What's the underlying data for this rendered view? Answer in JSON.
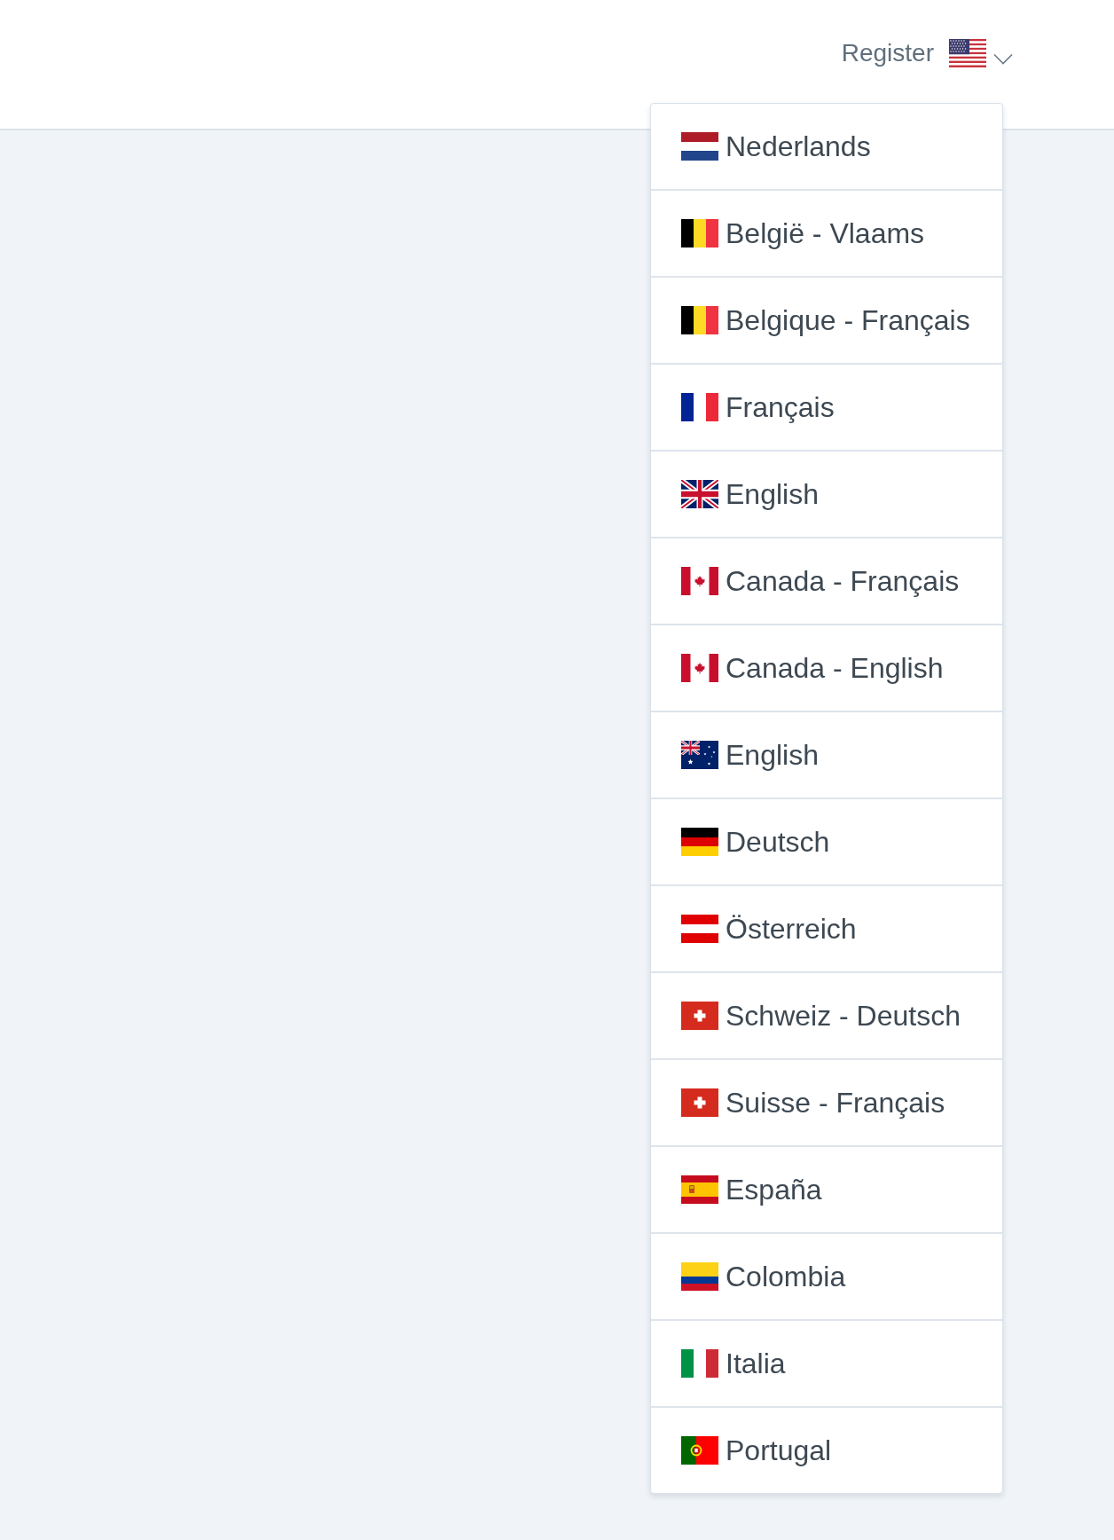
{
  "header": {
    "register_link": "Register",
    "language_toggle": {
      "kind": "usa",
      "expanded": true
    }
  },
  "language_menu": {
    "items": [
      {
        "kind": "netherlands",
        "label": "Nederlands"
      },
      {
        "kind": "belgium",
        "label": "België - Vlaams"
      },
      {
        "kind": "belgium",
        "label": "Belgique - Français"
      },
      {
        "kind": "france",
        "label": "Français"
      },
      {
        "kind": "uk",
        "label": "English"
      },
      {
        "kind": "canada",
        "label": "Canada - Français"
      },
      {
        "kind": "canada",
        "label": "Canada - English"
      },
      {
        "kind": "australia",
        "label": "English"
      },
      {
        "kind": "germany",
        "label": "Deutsch"
      },
      {
        "kind": "austria",
        "label": "Österreich"
      },
      {
        "kind": "switzerland",
        "label": "Schweiz - Deutsch"
      },
      {
        "kind": "switzerland",
        "label": "Suisse - Français"
      },
      {
        "kind": "spain",
        "label": "España"
      },
      {
        "kind": "colombia",
        "label": "Colombia"
      },
      {
        "kind": "italy",
        "label": "Italia"
      },
      {
        "kind": "portugal",
        "label": "Portugal"
      }
    ]
  }
}
